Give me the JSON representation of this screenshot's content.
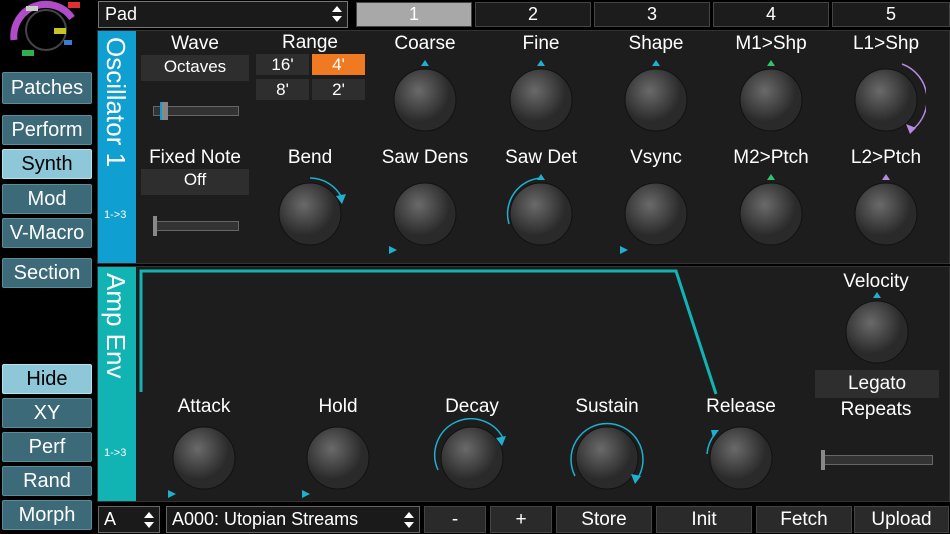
{
  "colors": {
    "accent": "#0f9fd0",
    "amp_accent": "#12b3b3",
    "range_on": "#f07a22",
    "knob_arc": "#1fb0d0"
  },
  "sidebar": {
    "main": [
      "Patches",
      "Perform",
      "Synth",
      "Mod",
      "V-Macro",
      "Section"
    ],
    "lower": [
      "Hide",
      "XY",
      "Perf",
      "Rand",
      "Morph"
    ]
  },
  "topbar": {
    "patch_category": "Pad",
    "tabs": [
      "1",
      "2",
      "3",
      "4",
      "5"
    ],
    "active_tab": "1"
  },
  "oscillator": {
    "title": "Oscillator 1",
    "routing": "1->3",
    "wave": {
      "label": "Wave",
      "value": "Octaves"
    },
    "range": {
      "label": "Range",
      "options": [
        "16'",
        "4'",
        "8'",
        "2'"
      ],
      "selected": "4'"
    },
    "fixed_note": {
      "label": "Fixed Note",
      "value": "Off"
    },
    "row1": [
      "Coarse",
      "Fine",
      "Shape",
      "M1>Shp",
      "L1>Shp"
    ],
    "row2": [
      "Bend",
      "Saw Dens",
      "Saw Det",
      "Vsync",
      "M2>Ptch",
      "L2>Ptch"
    ]
  },
  "amp_env": {
    "title": "Amp Env",
    "routing": "1->3",
    "knobs": [
      "Attack",
      "Hold",
      "Decay",
      "Sustain",
      "Release"
    ],
    "velocity": "Velocity",
    "legato": "Legato",
    "repeats": "Repeats"
  },
  "bottombar": {
    "bank": "A",
    "patch_name": "A000: Utopian Streams",
    "buttons": [
      "-",
      "+",
      "Store",
      "Init",
      "Fetch",
      "Upload"
    ]
  }
}
